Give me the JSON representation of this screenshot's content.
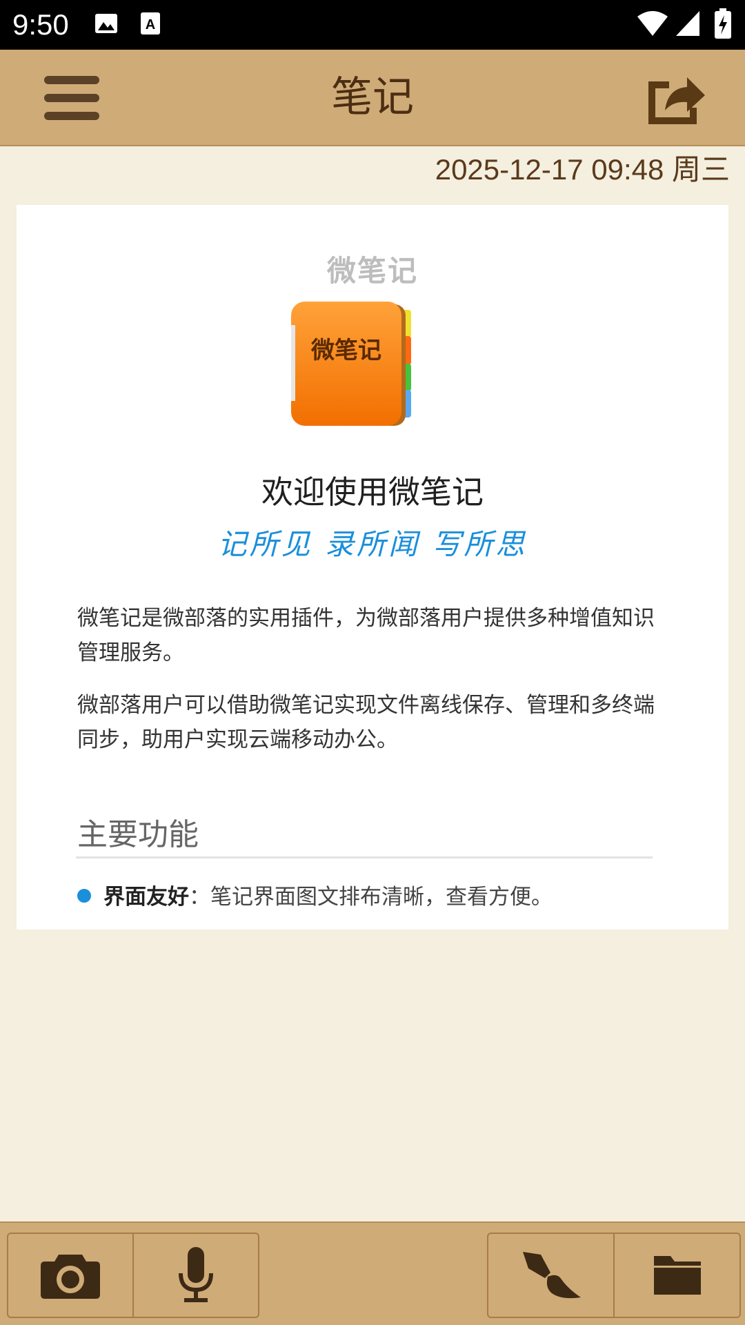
{
  "status_bar": {
    "time": "9:50",
    "icons": [
      "image-icon",
      "font-icon",
      "wifi-icon",
      "signal-icon",
      "battery-charging-icon"
    ]
  },
  "app_bar": {
    "title": "笔记",
    "menu_icon": "hamburger-menu-icon",
    "share_icon": "share-icon"
  },
  "note": {
    "datetime": "2025-12-17 09:48 周三"
  },
  "content": {
    "brand_small": "微笔记",
    "logo_text": "微笔记",
    "welcome_title": "欢迎使用微笔记",
    "slogan": "记所见 录所闻 写所思",
    "paragraph1": "微笔记是微部落的实用插件，为微部落用户提供多种增值知识管理服务。",
    "paragraph2": "微部落用户可以借助微笔记实现文件离线保存、管理和多终端同步，助用户实现云端移动办公。",
    "section_title": "主要功能",
    "features": [
      {
        "name": "界面友好",
        "separator": "：",
        "desc": "笔记界面图文排布清晰，查看方便。"
      }
    ]
  },
  "toolbar": {
    "left": [
      "camera-icon",
      "microphone-icon"
    ],
    "right": [
      "brush-icon",
      "folder-icon"
    ]
  },
  "colors": {
    "app_bar": "#cfab78",
    "background": "#f4efde",
    "accent_blue": "#1b8fdb",
    "title_brown": "#4b2e12",
    "logo_orange": "#ff8a1a"
  }
}
